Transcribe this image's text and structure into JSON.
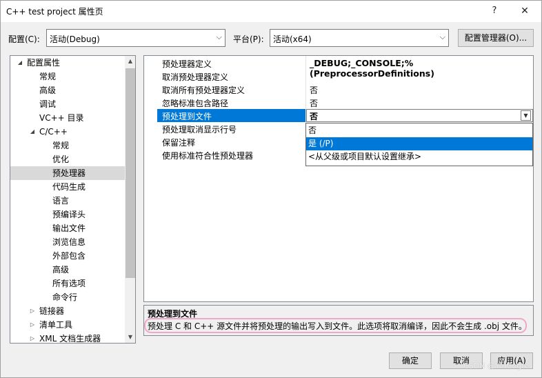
{
  "window": {
    "title": "C++ test project 属性页",
    "help_icon": "?",
    "close_icon": "✕"
  },
  "toolbar": {
    "config_label": "配置(C):",
    "config_value": "活动(Debug)",
    "platform_label": "平台(P):",
    "platform_value": "活动(x64)",
    "config_manager_button": "配置管理器(O)..."
  },
  "tree": {
    "root": "配置属性",
    "items": [
      "常规",
      "高级",
      "调试",
      "VC++ 目录"
    ],
    "cpp_group": "C/C++",
    "cpp_items": [
      "常规",
      "优化",
      "预处理器",
      "代码生成",
      "语言",
      "预编译头",
      "输出文件",
      "浏览信息",
      "外部包含",
      "高级",
      "所有选项",
      "命令行"
    ],
    "collapsed_items": [
      "链接器",
      "清单工具",
      "XML 文档生成器"
    ],
    "selected": "预处理器"
  },
  "properties": [
    {
      "name": "预处理器定义",
      "value": "_DEBUG;_CONSOLE;%(PreprocessorDefinitions)"
    },
    {
      "name": "取消预处理器定义",
      "value": ""
    },
    {
      "name": "取消所有预处理器定义",
      "value": "否"
    },
    {
      "name": "忽略标准包含路径",
      "value": "否"
    },
    {
      "name": "预处理到文件",
      "value": "否"
    },
    {
      "name": "预处理取消显示行号",
      "value": ""
    },
    {
      "name": "保留注释",
      "value": ""
    },
    {
      "name": "使用标准符合性预处理器",
      "value": ""
    }
  ],
  "dropdown_options": [
    "否",
    "是 (/P)",
    "<从父级或项目默认设置继承>"
  ],
  "description": {
    "title": "预处理到文件",
    "text": "预处理 C 和 C++ 源文件并将预处理的输出写入到文件。此选项将取消编译，因此不会生成 .obj 文件。"
  },
  "buttons": {
    "ok": "确定",
    "cancel": "取消",
    "apply": "应用(A)"
  },
  "watermark": "CSDN @YMGogre",
  "colors": {
    "accent": "#0078d7",
    "highlight_outline": "#f0a8c8"
  }
}
